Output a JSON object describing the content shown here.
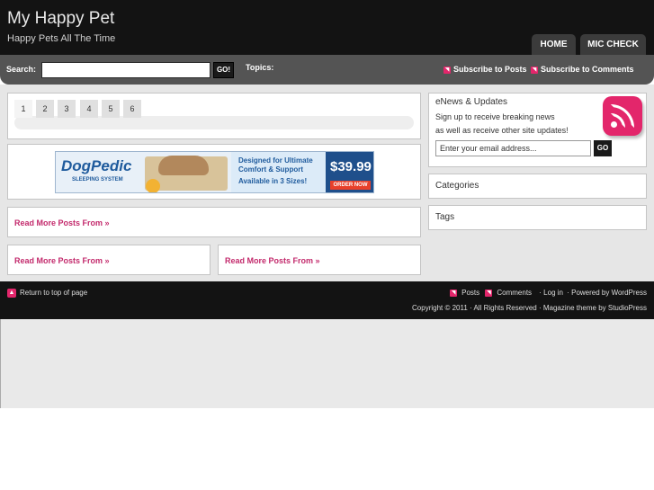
{
  "header": {
    "title": "My Happy Pet",
    "description": "Happy Pets All The Time",
    "nav": [
      "HOME",
      "MIC CHECK"
    ]
  },
  "searchbar": {
    "label": "Search:",
    "value": "",
    "go": "GO!",
    "topics_label": "Topics:",
    "subscribe_posts": "Subscribe to Posts",
    "subscribe_comments": "Subscribe to Comments"
  },
  "pager": {
    "pages": [
      "1",
      "2",
      "3",
      "4",
      "5",
      "6"
    ],
    "current": "1"
  },
  "ad": {
    "brand": "DogPedic",
    "sub": "SLEEPING SYSTEM",
    "line1": "Designed for Ultimate",
    "line2": "Comfort & Support",
    "line3": "Available in 3 Sizes!",
    "price": "$39.99",
    "cta": "ORDER NOW"
  },
  "main": {
    "read_more_1": "Read More Posts From »",
    "read_more_2": "Read More Posts From »",
    "read_more_3": "Read More Posts From »"
  },
  "sidebar": {
    "enews_title": "eNews & Updates",
    "enews_desc_1": "Sign up to receive breaking news",
    "enews_desc_2": "as well as receive other site updates!",
    "email_placeholder": "Enter your email address...",
    "email_go": "GO",
    "categories_title": "Categories",
    "tags_title": "Tags"
  },
  "footer": {
    "return_top": "Return to top of page",
    "posts": "Posts",
    "comments": "Comments",
    "login": "· Log in",
    "powered": "· Powered by WordPress",
    "copyright": "Copyright © 2011 · All Rights Reserved · Magazine theme by StudioPress"
  },
  "colors": {
    "accent": "#e3266b",
    "header_bg": "#131313",
    "link": "#c32a6c"
  }
}
